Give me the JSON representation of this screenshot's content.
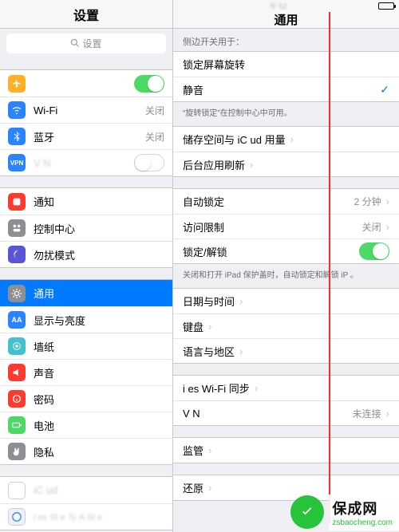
{
  "status": {
    "time_blurred": "午  52",
    "carrier_blurred": ""
  },
  "sidebar": {
    "title": "设置",
    "search_placeholder": "设置",
    "groups": [
      {
        "rows": [
          {
            "id": "airplane",
            "label_blurred": true,
            "label": " ",
            "icon": "airplane-icon",
            "icon_bg": "#ffb028",
            "toggle": true,
            "toggle_on": true
          },
          {
            "id": "wifi",
            "label": "Wi-Fi",
            "icon": "wifi-icon",
            "icon_bg": "#2a84ff",
            "value": "关闭"
          },
          {
            "id": "bluetooth",
            "label": "蓝牙",
            "icon": "bluetooth-icon",
            "icon_bg": "#2a84ff",
            "value": "关闭"
          },
          {
            "id": "vpn",
            "label": "V  N",
            "label_blurred": true,
            "icon": "vpn-icon",
            "icon_bg": "#2a84ff",
            "toggle": true,
            "toggle_on": false
          }
        ]
      },
      {
        "rows": [
          {
            "id": "notifications",
            "label": "通知",
            "icon": "bell-icon",
            "icon_bg": "#ff3b30"
          },
          {
            "id": "controlcenter",
            "label": "控制中心",
            "icon": "control-center-icon",
            "icon_bg": "#8e8e93"
          },
          {
            "id": "dnd",
            "label": "勿扰模式",
            "icon": "moon-icon",
            "icon_bg": "#5856d6"
          }
        ]
      },
      {
        "rows": [
          {
            "id": "general",
            "label": "通用",
            "icon": "gear-icon",
            "icon_bg": "#8e8e93",
            "selected": true
          },
          {
            "id": "display",
            "label": "显示与亮度",
            "icon": "display-icon",
            "icon_bg": "#2a84ff"
          },
          {
            "id": "wallpaper",
            "label": "墙纸",
            "icon": "wallpaper-icon",
            "icon_bg": "#43c1cc"
          },
          {
            "id": "sound",
            "label": "声音",
            "icon": "sound-icon",
            "icon_bg": "#ff3b30"
          },
          {
            "id": "passcode",
            "label": "密码",
            "icon": "passcode-icon",
            "icon_bg": "#ff3b30"
          },
          {
            "id": "battery",
            "label": "电池",
            "icon": "battery-icon",
            "icon_bg": "#4cd964"
          },
          {
            "id": "privacy",
            "label": "隐私",
            "icon": "hand-icon",
            "icon_bg": "#8e8e93"
          }
        ]
      },
      {
        "rows": [
          {
            "id": "icloud",
            "label": "iC   ud",
            "label_blurred": true,
            "icon": "cloud-icon",
            "icon_bg": "#ffffff"
          },
          {
            "id": "appstore",
            "label": "i    es St   e 与 A   St   e",
            "label_blurred": true,
            "icon": "appstore-icon",
            "icon_bg": "#f0f0f5"
          }
        ]
      }
    ]
  },
  "detail": {
    "title": "通用",
    "caption_side_switch": "侧边开关用于：",
    "group_side_switch": [
      {
        "id": "lock-rotation",
        "label": "锁定屏幕旋转"
      },
      {
        "id": "mute",
        "label": "静音",
        "checked": true
      }
    ],
    "note_rotation": "“旋转锁定”在控制中心中可用。",
    "group_storage": [
      {
        "id": "storage",
        "label": "储存空间与 iC   ud 用量",
        "label_blurred": true,
        "chevron": true
      },
      {
        "id": "refresh",
        "label": "后台应用刷新",
        "chevron": true
      }
    ],
    "group_lock": [
      {
        "id": "autolock",
        "label": "自动锁定",
        "value": "2 分钟",
        "chevron": true
      },
      {
        "id": "restrictions",
        "label": "访问限制",
        "value": "关闭",
        "chevron": true
      },
      {
        "id": "lockunlock",
        "label": "锁定/解锁",
        "toggle": true,
        "toggle_on": true
      }
    ],
    "lock_note": "关闭和打开 iPad 保护盖时，自动锁定和解锁 iP   。",
    "group_datetime": [
      {
        "id": "datetime",
        "label": "日期与时间",
        "chevron": true
      },
      {
        "id": "keyboard",
        "label": "键盘",
        "chevron": true
      },
      {
        "id": "language",
        "label": "语言与地区",
        "chevron": true
      }
    ],
    "group_sync": [
      {
        "id": "itunes-wifi",
        "label": "i    es Wi-Fi 同步",
        "label_blurred": true,
        "chevron": true
      },
      {
        "id": "vpn2",
        "label": "V  N",
        "label_blurred": true,
        "value": "未连接",
        "chevron": true
      }
    ],
    "group_profiles": [
      {
        "id": "supervision",
        "label": "监管",
        "chevron": true
      }
    ],
    "group_reset": [
      {
        "id": "reset",
        "label": "还原",
        "chevron": true
      }
    ]
  },
  "watermark": {
    "cn": "保成网",
    "url": "zsbaocheng.com"
  }
}
